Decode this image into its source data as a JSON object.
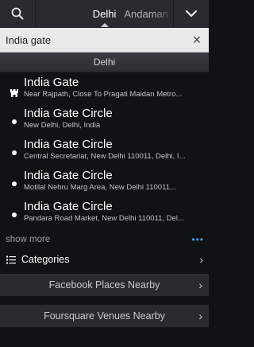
{
  "topbar": {
    "tabs": [
      {
        "label": "Delhi",
        "active": true
      },
      {
        "label": "Andaman",
        "active": false
      }
    ],
    "icons": {
      "search": "search-icon",
      "menu": "chevron-down-icon"
    }
  },
  "search": {
    "value": "India gate",
    "clear_symbol": "×"
  },
  "section": {
    "title": "Delhi"
  },
  "results": [
    {
      "icon": "castle-icon",
      "title": "India Gate",
      "sub": "Near Rajpath, Close To Pragati Maidan Metro..."
    },
    {
      "icon": "dot",
      "title": "India Gate Circle",
      "sub": "New Delhi, Delhi, India"
    },
    {
      "icon": "dot",
      "title": "India Gate Circle",
      "sub": "Central Secretariat, New Delhi 110011, Delhi, I..."
    },
    {
      "icon": "dot",
      "title": "India Gate Circle",
      "sub": "Motilal Nehru Marg Area, New Delhi 110011..."
    },
    {
      "icon": "dot",
      "title": "India Gate Circle",
      "sub": "Pandara Road Market, New Delhi 110011, Del..."
    }
  ],
  "showmore": {
    "label": "show more",
    "dots": "•••"
  },
  "categories": {
    "label": "Categories"
  },
  "bands": [
    {
      "label": "Facebook Places Nearby"
    },
    {
      "label": "Foursquare Venues Nearby"
    }
  ],
  "colors": {
    "accent": "#3aa0e6",
    "background": "#111214",
    "bar": "#2a2b2e"
  }
}
